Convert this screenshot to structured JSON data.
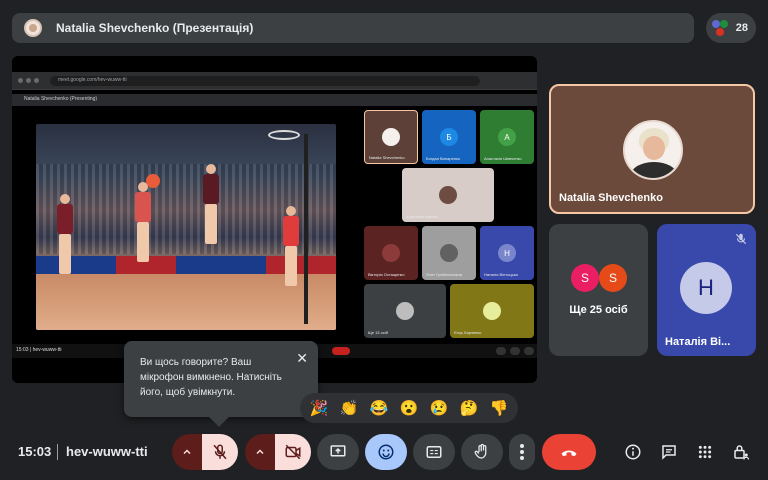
{
  "header": {
    "presenter_title": "Natalia Shevchenko (Презентація)",
    "participant_count": "28"
  },
  "shared_screen": {
    "url_text": "meet.google.com/hev-wuww-tti",
    "inner_title": "Natalia Shevchenko (Presenting)",
    "time": "15:03",
    "meeting_code": "hev-wuww-tti",
    "thumbnails": [
      {
        "label": "Natalia Shevchenko",
        "letter": "",
        "bg": "#5d4037"
      },
      {
        "label": "Богдан Винаренко",
        "letter": "Б",
        "bg": "#1565c0"
      },
      {
        "label": "Анастасія Шевченко",
        "letter": "А",
        "bg": "#2e7d32"
      },
      {
        "label": "Христина Коваль",
        "letter": "",
        "bg": "#d7ccc8"
      },
      {
        "label": "Вікторія Остащенко",
        "letter": "",
        "bg": "#8d3a3a"
      },
      {
        "label": "Олег Гребельников",
        "letter": "",
        "bg": "#9e9e9e"
      },
      {
        "label": "Наталія Вінтоцька",
        "letter": "Н",
        "bg": "#3949ab"
      },
      {
        "label": "Ще 13 осіб",
        "letter": "",
        "bg": "#3c4043"
      },
      {
        "label": "Єгор Харченко",
        "letter": "",
        "bg": "#827717"
      }
    ]
  },
  "tiles": {
    "main_name": "Natalia Shevchenko",
    "others_label": "Ще 25 осіб",
    "others_avatars": [
      {
        "letter": "S",
        "color": "#e91e63"
      },
      {
        "letter": "S",
        "color": "#e64a19"
      }
    ],
    "nv_letter": "Н",
    "nv_name": "Наталія Ві..."
  },
  "tooltip": {
    "text": "Ви щось говорите? Ваш мікрофон вимкнено. Натисніть його, щоб увімкнути.",
    "close": "✕"
  },
  "reactions": [
    "🎉",
    "👏",
    "😂",
    "😮",
    "😢",
    "🤔",
    "👎"
  ],
  "footer": {
    "time": "15:03",
    "meeting_code": "hev-wuww-tti"
  },
  "colors": {
    "background": "#202124",
    "surface": "#3c4043",
    "end_call": "#ea4335",
    "mic_off_bg": "#f9dedc",
    "accent_blue": "#a8c7fa"
  }
}
